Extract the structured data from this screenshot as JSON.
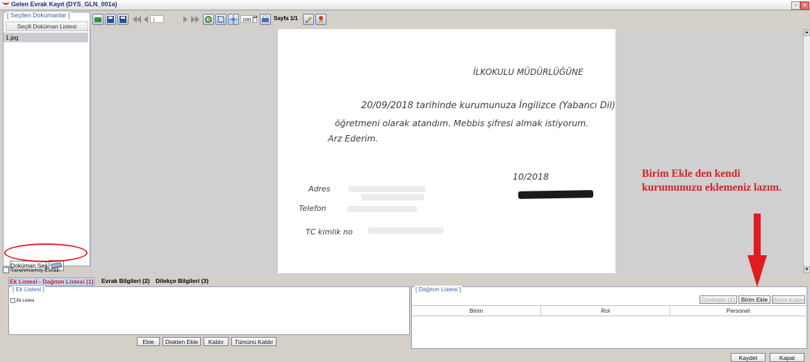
{
  "window": {
    "title": "Gelen Evrak Kayıt (DYS_GLN_001a)",
    "restore_icon": "restore-icon",
    "close_icon": "close-icon"
  },
  "left_panel": {
    "legend": "[ Seçilen Dokümanlar ]",
    "column_header": "Seçili Doküman Listesi",
    "items": [
      "1.jpg"
    ],
    "select_button": "Doküman Seç",
    "unscanned_label": "Taranmamış Evrak"
  },
  "toolbar": {
    "page_input": "1",
    "zoom": "100",
    "page_label": "Sayfa 1/1"
  },
  "document": {
    "line_header": "İLKOKULU MÜDÜRLÜĞÜNE",
    "line1": "20/09/2018 tarihinde kurumunuza İngilizce (Yabancı Dil)",
    "line2": "öğretmeni olarak atandım. Mebbis şifresi almak istiyorum.",
    "line3": "Arz Ederim.",
    "date": "10/2018",
    "address_label": "Adres",
    "phone_label": "Telefon",
    "tc_label": "TC kimlik no"
  },
  "annotation": {
    "text": "Birim Ekle den kendi kurumunuzu eklemeniz lazım.",
    "color": "#d3242a"
  },
  "tabs": [
    {
      "label": "Ek Listesi - Dağıtım Listesi (1)",
      "active": true
    },
    {
      "label": "Evrak Bilgileri (2)",
      "active": false
    },
    {
      "label": "Dilekçe Bilgileri (3)",
      "active": false
    }
  ],
  "ek_panel": {
    "legend": "[ Ek Listesi ]",
    "tree_root": "Ek Listesi",
    "buttons": [
      "Ekle",
      "Diskten Ekle",
      "Kaldır",
      "Tümünü Kaldır"
    ]
  },
  "dagitim_panel": {
    "legend": "[ Dağıtım Listesi ]",
    "buttons": [
      "Özelleştir (X)",
      "Birim Ekle",
      "Birimi Kaldır"
    ],
    "columns": [
      "Birim",
      "Rol",
      "Personel"
    ]
  },
  "footer": {
    "save": "Kaydet",
    "close": "Kapat"
  }
}
